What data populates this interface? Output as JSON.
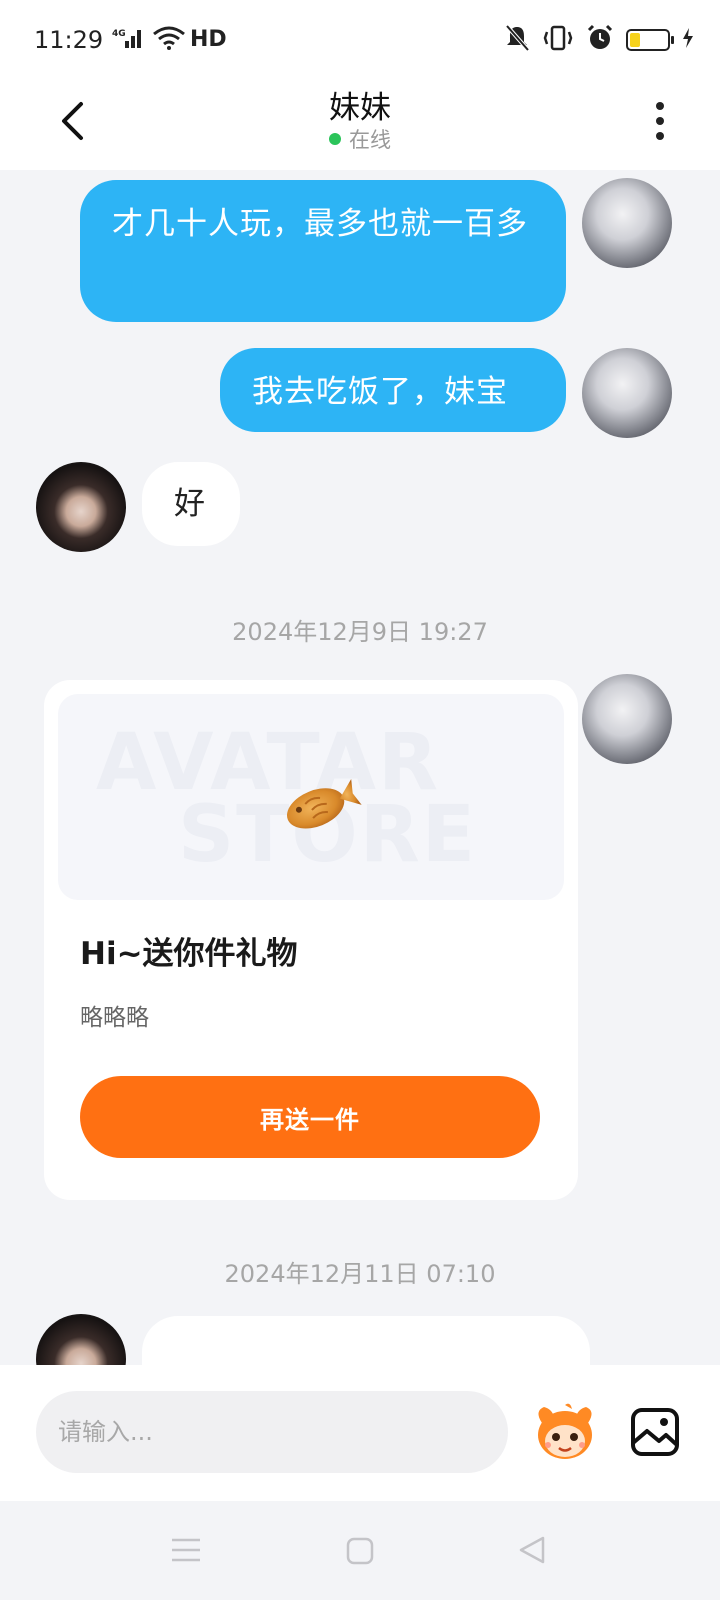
{
  "status_bar": {
    "time": "11:29",
    "network": "4G",
    "hd_label": "HD",
    "battery_color": "#f6d21c"
  },
  "header": {
    "title": "妹妹",
    "status": "在线",
    "status_color": "#2bc45a"
  },
  "messages": [
    {
      "from": "self",
      "text": "才几十人玩，最多也就一百多"
    },
    {
      "from": "self",
      "text": "我去吃饭了，妹宝"
    },
    {
      "from": "other",
      "text": "好"
    },
    {
      "type": "time",
      "text": "2024年12月9日 19:27"
    },
    {
      "from": "self",
      "type": "gift",
      "watermark_line1": "AVATAR",
      "watermark_line2": "STORE",
      "title": "Hi~送你件礼物",
      "description": "略略略",
      "button_label": "再送一件",
      "button_color": "#ff7012"
    },
    {
      "type": "time",
      "text": "2024年12月11日 07:10"
    }
  ],
  "input": {
    "placeholder": "请输入..."
  },
  "icons": {
    "back": "chevron-left-icon",
    "more": "more-vertical-icon",
    "emoji": "mascot-emoji-icon",
    "image": "image-icon",
    "nav_menu": "menu-icon",
    "nav_home": "square-icon",
    "nav_back": "triangle-back-icon"
  },
  "colors": {
    "self_bubble": "#2db4f5",
    "background": "#f3f4f7"
  }
}
